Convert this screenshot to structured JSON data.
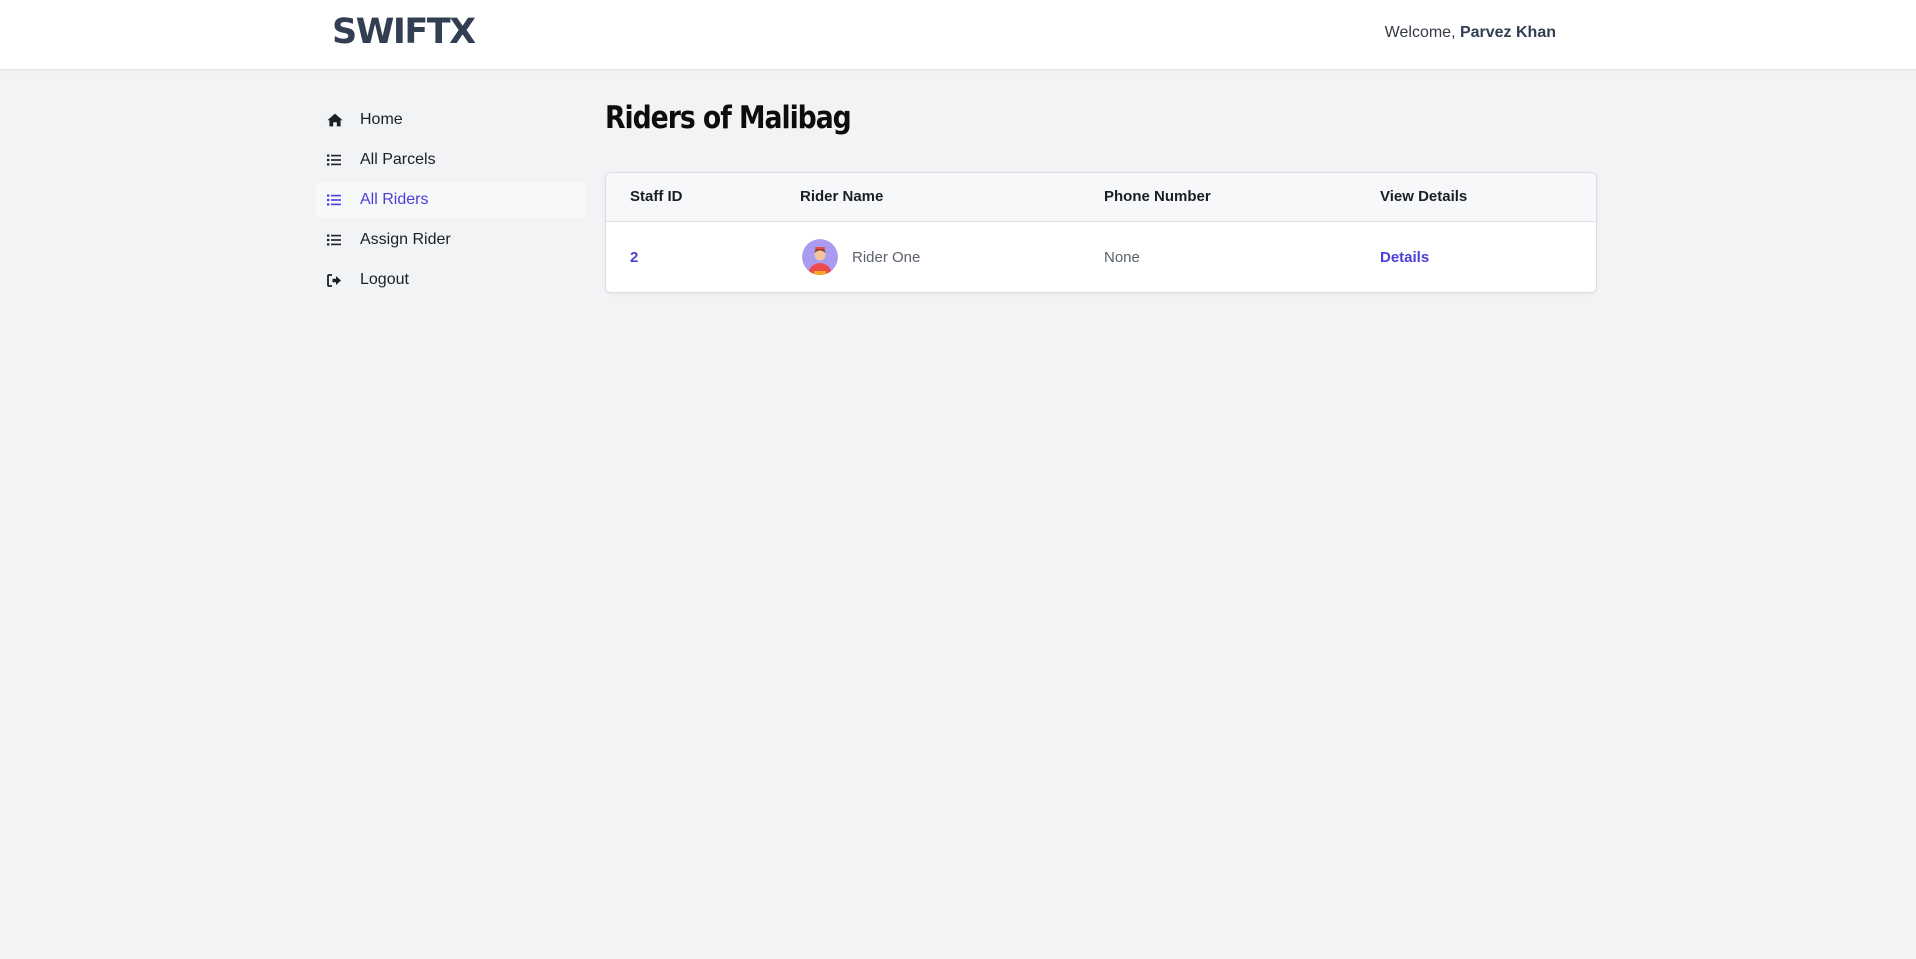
{
  "header": {
    "logo": "SWIFTX",
    "welcome_prefix": "Welcome, ",
    "user_name": "Parvez Khan"
  },
  "sidebar": {
    "items": [
      {
        "label": "Home",
        "icon": "home-icon",
        "active": false
      },
      {
        "label": "All Parcels",
        "icon": "list-icon",
        "active": false
      },
      {
        "label": "All Riders",
        "icon": "list-icon",
        "active": true
      },
      {
        "label": "Assign Rider",
        "icon": "list-icon",
        "active": false
      },
      {
        "label": "Logout",
        "icon": "logout-icon",
        "active": false
      }
    ]
  },
  "main": {
    "title": "Riders of Malibag",
    "table": {
      "headers": [
        "Staff ID",
        "Rider Name",
        "Phone Number",
        "View Details"
      ],
      "rows": [
        {
          "staff_id": "2",
          "rider_name": "Rider One",
          "phone": "None",
          "details": "Details"
        }
      ]
    }
  },
  "colors": {
    "accent": "#4a3fd6",
    "background": "#f2f3f5",
    "logo": "#323e52"
  }
}
